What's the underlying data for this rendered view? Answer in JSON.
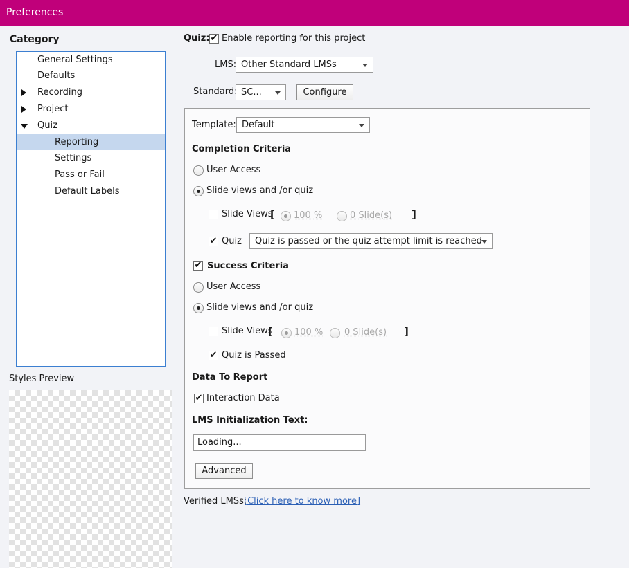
{
  "window": {
    "title": "Preferences"
  },
  "sidebar": {
    "heading": "Category",
    "items": [
      {
        "label": "General Settings"
      },
      {
        "label": "Defaults"
      },
      {
        "label": "Recording"
      },
      {
        "label": "Project"
      },
      {
        "label": "Quiz"
      },
      {
        "label": "Reporting",
        "selected": true
      },
      {
        "label": "Settings"
      },
      {
        "label": "Pass or Fail"
      },
      {
        "label": "Default Labels"
      }
    ],
    "styles_preview_label": "Styles Preview"
  },
  "main": {
    "quiz_label": "Quiz:",
    "enable_reporting": {
      "label": "Enable reporting for this project",
      "checked": true
    },
    "lms": {
      "label": "LMS:",
      "value": "Other Standard LMSs"
    },
    "standard": {
      "label": "Standard:",
      "value": "SC...",
      "configure_label": "Configure"
    },
    "template": {
      "label": "Template:",
      "value": "Default"
    },
    "completion": {
      "heading": "Completion Criteria",
      "user_access_label": "User Access",
      "slide_views_quiz_label": "Slide views and /or quiz",
      "selected": "slide_views_quiz",
      "slide_views": {
        "label": "Slide Views",
        "checked": false,
        "percent_label": "100 %",
        "slides_label": "0 Slide(s)"
      },
      "quiz": {
        "label": "Quiz",
        "checked": true,
        "condition": "Quiz is passed or the quiz attempt limit is reached"
      }
    },
    "success": {
      "heading": "Success Criteria",
      "checked": true,
      "user_access_label": "User Access",
      "slide_views_quiz_label": "Slide views and /or quiz",
      "selected": "slide_views_quiz",
      "slide_views": {
        "label": "Slide Views",
        "checked": false,
        "percent_label": "100 %",
        "slides_label": "0 Slide(s)"
      },
      "quiz_passed": {
        "label": "Quiz is Passed",
        "checked": true
      }
    },
    "data_to_report": {
      "heading": "Data To Report",
      "interaction_data": {
        "label": "Interaction Data",
        "checked": true
      }
    },
    "lms_init": {
      "heading": "LMS Initialization Text:",
      "value": "Loading..."
    },
    "advanced_label": "Advanced",
    "verified_lms": {
      "label": "Verified LMSs:",
      "link": "[Click here to know more]"
    }
  },
  "icons": {
    "check": "✔",
    "expand": "triangle-right",
    "collapse": "triangle-down"
  },
  "colors": {
    "titlebar": "#c0007a",
    "selection": "#c5d7ee",
    "link": "#2b5fb5"
  }
}
